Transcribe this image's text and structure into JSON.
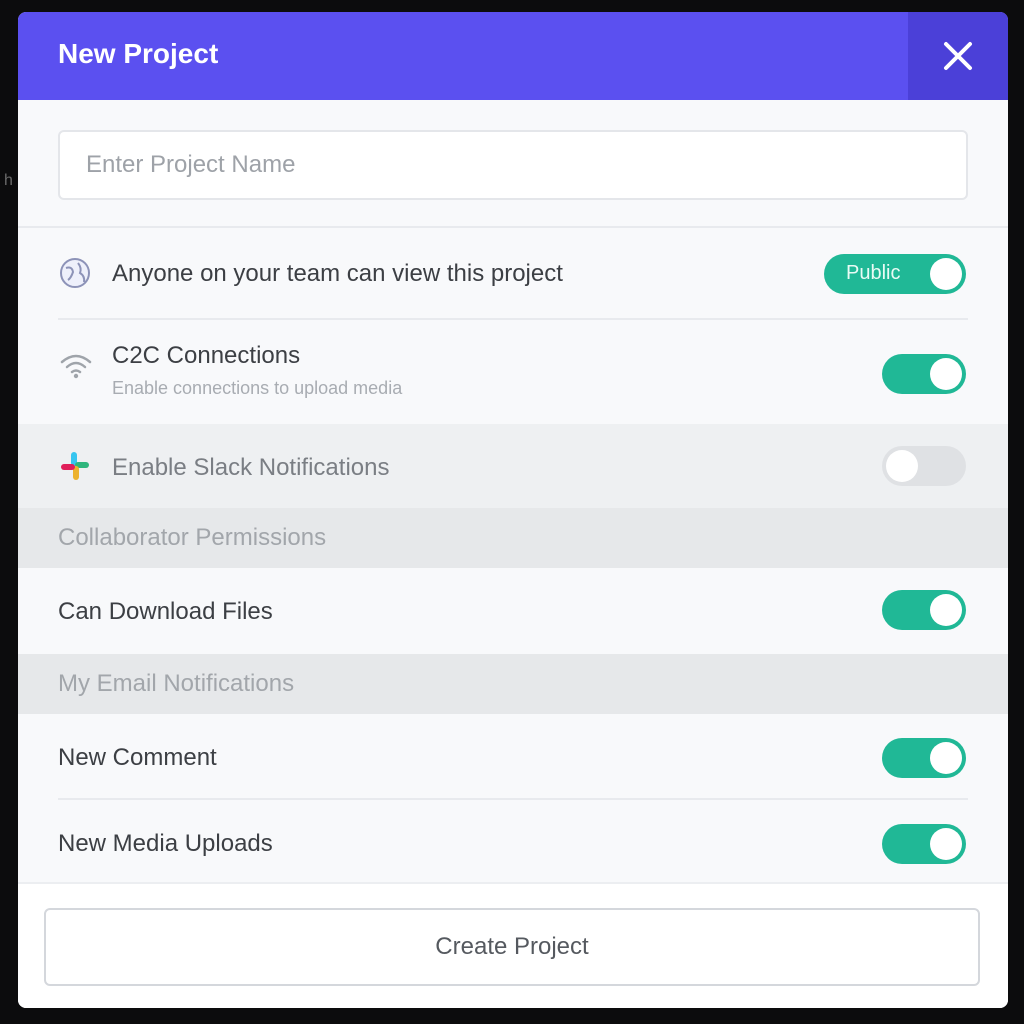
{
  "modal": {
    "title": "New Project",
    "close_icon": "close-icon"
  },
  "project_name": {
    "value": "",
    "placeholder": "Enter Project Name"
  },
  "visibility": {
    "icon": "globe-icon",
    "label": "Anyone on your team can view this project",
    "toggle_label": "Public",
    "enabled": true
  },
  "c2c": {
    "icon": "wifi-icon",
    "title": "C2C Connections",
    "subtitle": "Enable connections to upload media",
    "enabled": true
  },
  "slack": {
    "icon": "slack-icon",
    "label": "Enable Slack Notifications",
    "enabled": false
  },
  "collaborator_permissions": {
    "heading": "Collaborator Permissions",
    "can_download": {
      "label": "Can Download Files",
      "enabled": true
    }
  },
  "email_notifications": {
    "heading": "My Email Notifications",
    "new_comment": {
      "label": "New Comment",
      "enabled": true
    },
    "new_media_uploads": {
      "label": "New Media Uploads",
      "enabled": true
    }
  },
  "footer": {
    "create_button": "Create Project"
  },
  "colors": {
    "header": "#5b50f0",
    "close_bg": "#4b40d8",
    "toggle_on": "#20b896",
    "toggle_off": "#dfe1e4"
  }
}
